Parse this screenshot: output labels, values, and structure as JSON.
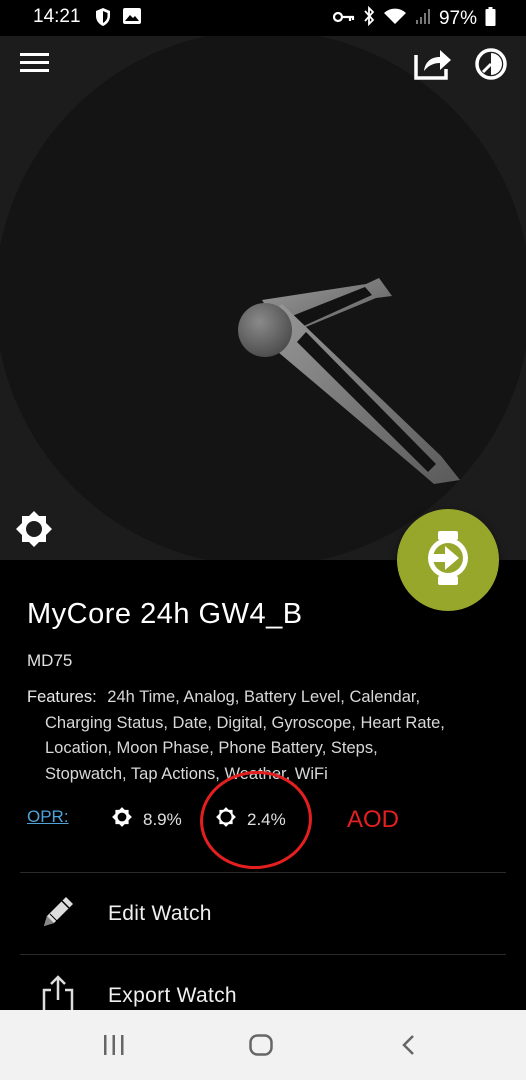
{
  "status_bar": {
    "time": "14:21",
    "battery": "97%",
    "left_icons": [
      "shield-icon",
      "image-icon"
    ],
    "right_icons": [
      "key-icon",
      "bluetooth-icon",
      "wifi-icon",
      "signal-icon",
      "battery-icon"
    ]
  },
  "toolbar": {
    "icons": [
      "menu-icon",
      "share-icon",
      "theme-icon"
    ]
  },
  "preview": {
    "background": "#1c1c1c",
    "face_color": "#141414",
    "fab_color": "#97a72c"
  },
  "watch": {
    "title": "MyCore 24h GW4_B",
    "model": "MD75",
    "features_label": "Features:",
    "feature_lines": [
      "24h Time,  Analog,  Battery Level,  Calendar,",
      "Charging Status,  Date,  Digital,  Gyroscope,  Heart Rate,",
      "Location,  Moon Phase,  Phone Battery,  Steps,",
      "Stopwatch,  Tap Actions,  Weather,  WiFi"
    ]
  },
  "opr": {
    "label": "OPR:",
    "normal_value": "8.9%",
    "aod_value": "2.4%",
    "aod_annotation": "AOD",
    "link_color": "#4fa3d8",
    "annotation_color": "#e41f1f"
  },
  "actions": [
    {
      "label": "Edit Watch",
      "icon": "pencil-icon"
    },
    {
      "label": "Export Watch",
      "icon": "export-icon"
    }
  ],
  "nav": {
    "icons": [
      "recent-apps-icon",
      "home-icon",
      "back-icon"
    ]
  }
}
